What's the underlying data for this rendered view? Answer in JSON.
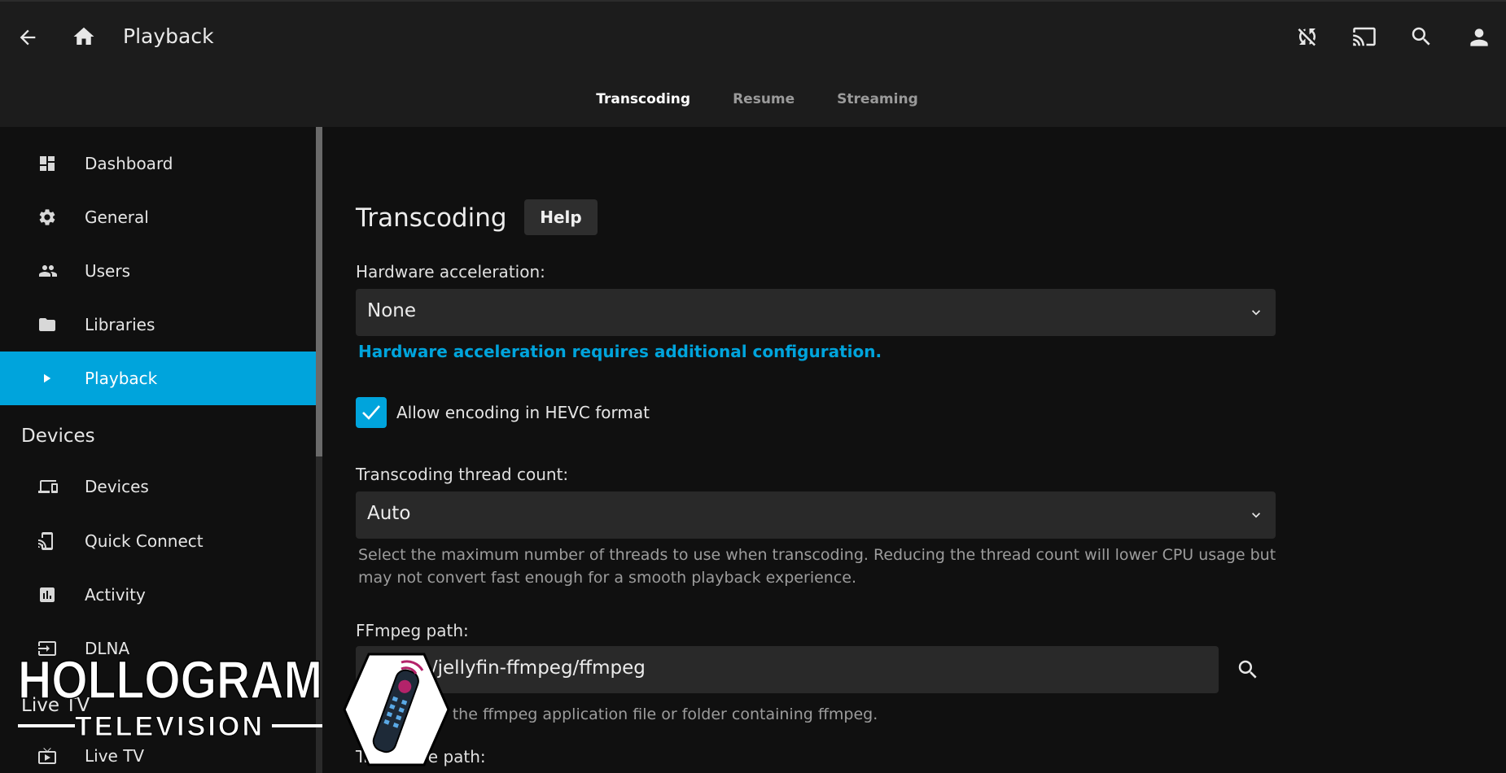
{
  "header": {
    "title": "Playback",
    "tabs": [
      {
        "label": "Transcoding",
        "active": true
      },
      {
        "label": "Resume",
        "active": false
      },
      {
        "label": "Streaming",
        "active": false
      }
    ],
    "icons": [
      "back-arrow-icon",
      "home-icon",
      "sync-disabled-icon",
      "cast-icon",
      "search-icon",
      "user-icon"
    ]
  },
  "sidebar": {
    "items": [
      {
        "label": "Dashboard",
        "icon": "dashboard-icon"
      },
      {
        "label": "General",
        "icon": "gear-icon"
      },
      {
        "label": "Users",
        "icon": "users-icon"
      },
      {
        "label": "Libraries",
        "icon": "folder-icon"
      },
      {
        "label": "Playback",
        "icon": "play-icon",
        "active": true
      }
    ],
    "devices_heading": "Devices",
    "device_items": [
      {
        "label": "Devices",
        "icon": "devices-icon"
      },
      {
        "label": "Quick Connect",
        "icon": "quick-connect-icon"
      },
      {
        "label": "Activity",
        "icon": "activity-icon"
      },
      {
        "label": "DLNA",
        "icon": "dlna-icon"
      }
    ],
    "livetv_heading": "Live TV",
    "livetv_items": [
      {
        "label": "Live TV",
        "icon": "tv-icon"
      }
    ]
  },
  "content": {
    "section_title": "Transcoding",
    "help_label": "Help",
    "hw_accel_label": "Hardware acceleration:",
    "hw_accel_value": "None",
    "hw_accel_link": "Hardware acceleration requires additional configuration.",
    "hevc_label": "Allow encoding in HEVC format",
    "hevc_checked": true,
    "thread_label": "Transcoding thread count:",
    "thread_value": "Auto",
    "thread_desc": "Select the maximum number of threads to use when transcoding. Reducing the thread count will lower CPU usage but may not convert fast enough for a smooth playback experience.",
    "ffmpeg_label": "FFmpeg path:",
    "ffmpeg_value": "/usr/lib/jellyfin-ffmpeg/ffmpeg",
    "ffmpeg_desc": "The path to the ffmpeg application file or folder containing ffmpeg.",
    "transcode_path_label": "Transcode path:"
  },
  "watermark": {
    "line1": "HOLLOGRAM",
    "line2": "TELEVISION"
  },
  "colors": {
    "accent": "#00a4dc",
    "header_bg": "#1c1c1c",
    "page_bg": "#101010",
    "field_bg": "#292929"
  }
}
